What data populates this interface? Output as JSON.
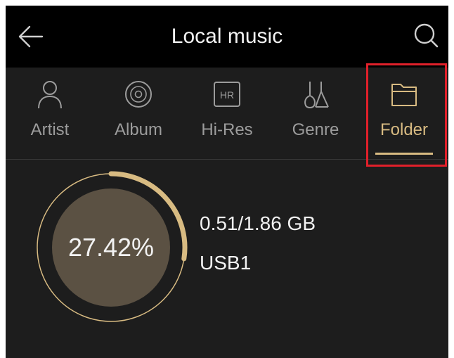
{
  "header": {
    "title": "Local music",
    "back_icon": "arrow-left-icon",
    "search_icon": "search-icon"
  },
  "tabs": [
    {
      "label": "Artist",
      "icon": "person-icon",
      "active": false
    },
    {
      "label": "Album",
      "icon": "disc-icon",
      "active": false
    },
    {
      "label": "Hi-Res",
      "icon": "hi-res-badge-icon",
      "badge_text": "HR",
      "active": false
    },
    {
      "label": "Genre",
      "icon": "guitar-icon",
      "active": false
    },
    {
      "label": "Folder",
      "icon": "folder-icon",
      "active": true
    }
  ],
  "storage": {
    "percent_label": "27.42%",
    "used_fraction": 0.2742,
    "usage": "0.51/1.86 GB",
    "device": "USB1"
  },
  "colors": {
    "accent": "#d8bb82",
    "background": "#1d1d1d",
    "header_background": "#000000",
    "highlight": "#e0202a",
    "inner_circle": "#5b5143"
  }
}
